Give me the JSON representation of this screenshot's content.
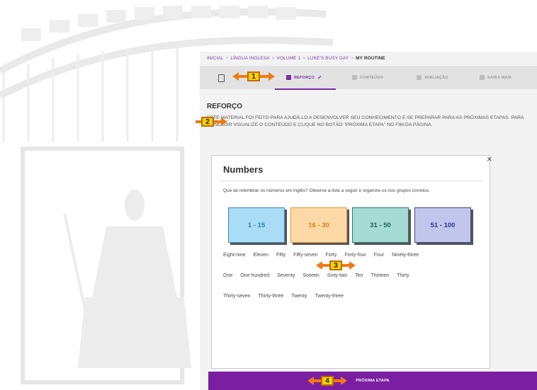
{
  "breadcrumb": {
    "items": [
      "INICIAL",
      "LÍNGUA INGLESA",
      "VOLUME 1",
      "LUKE'S BUSY DAY"
    ],
    "current": "MY ROUTINE",
    "separator": ">"
  },
  "tabs": [
    {
      "label": "REFORÇO",
      "active": true,
      "icon": "grid-icon"
    },
    {
      "label": "CONTEÚDO",
      "active": false,
      "icon": "people-icon"
    },
    {
      "label": "AVALIAÇÃO",
      "active": false,
      "icon": "check-square-icon"
    },
    {
      "label": "SAIBA MAIS",
      "active": false,
      "icon": "plus-square-icon"
    }
  ],
  "section": {
    "title": "REFORÇO",
    "intro": "Este material foi feito para ajudá-lo a desenvolver seu conhecimento e se preparar para as próximas etapas. Para concluir visualize o conteúdo e clique no botão \"PRÓXIMA ETAPA\" no fim da página."
  },
  "card": {
    "title": "Numbers",
    "close": "×",
    "question": "Que tal relembrar os números em inglês? Observe a lista a seguir e organize-os nos grupos corretos.",
    "groups": [
      {
        "label": "1 - 15",
        "bg": "#a9dcf6",
        "border": "#3a8fc4",
        "text": "#2a7fb8"
      },
      {
        "label": "16 - 30",
        "bg": "#fdd9a8",
        "border": "#e8952e",
        "text": "#e07b14"
      },
      {
        "label": "31 - 50",
        "bg": "#a6dbd5",
        "border": "#2c7a70",
        "text": "#1f5e56"
      },
      {
        "label": "51 - 100",
        "bg": "#c3c6ec",
        "border": "#3e4499",
        "text": "#2f3588"
      }
    ],
    "word_rows": [
      [
        "Eight-nine",
        "Eleven",
        "Fifty",
        "Fifty-seven",
        "Forty",
        "Forty-four",
        "Four",
        "Ninety-three"
      ],
      [
        "One",
        "One hundred",
        "Seventy",
        "Sixteen",
        "Sixty-two",
        "Ten",
        "Thirteen",
        "Thirty"
      ],
      [
        "Thirty-seven",
        "Thirty-three",
        "Twenty",
        "Twenty-three"
      ]
    ]
  },
  "next_button": {
    "label": "PRÓXIMA ETAPA"
  },
  "markers": [
    "1",
    "2",
    "3",
    "4"
  ],
  "colors": {
    "accent": "#7a1fa2",
    "marker_arrow": "#f07a14",
    "marker_box": "#f5d000"
  }
}
